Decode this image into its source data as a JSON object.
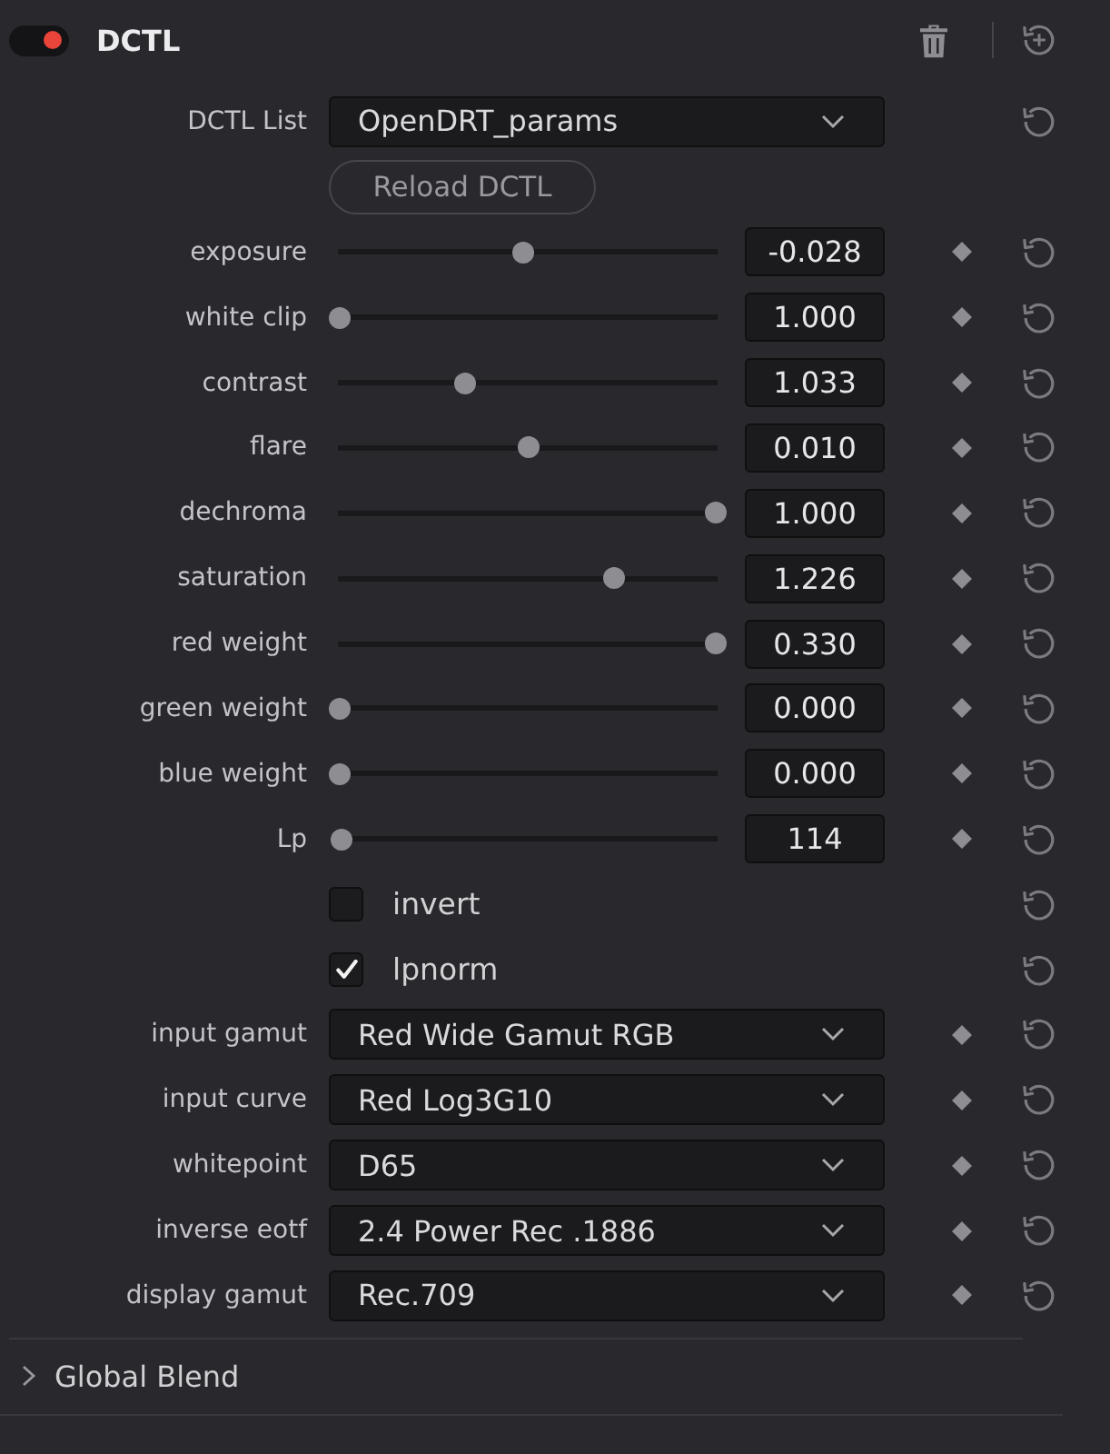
{
  "header": {
    "title": "DCTL",
    "enabled": true
  },
  "dctl_list": {
    "label": "DCTL List",
    "value": "OpenDRT_params",
    "button": "Reload DCTL"
  },
  "params": [
    {
      "kind": "slider",
      "label": "exposure",
      "level": 0.49,
      "value": "-0.028"
    },
    {
      "kind": "slider",
      "label": "white clip",
      "level": 0,
      "value": "1.000"
    },
    {
      "kind": "slider",
      "label": "contrast",
      "level": 0.335,
      "value": "1.033"
    },
    {
      "kind": "slider",
      "label": "flare",
      "level": 0.5,
      "value": "0.010"
    },
    {
      "kind": "slider",
      "label": "dechroma",
      "level": 1,
      "value": "1.000"
    },
    {
      "kind": "slider",
      "label": "saturation",
      "level": 0.73,
      "value": "1.226"
    },
    {
      "kind": "slider",
      "label": "red weight",
      "level": 1,
      "value": "0.330"
    },
    {
      "kind": "slider",
      "label": "green weight",
      "level": 0,
      "value": "0.000"
    },
    {
      "kind": "slider",
      "label": "blue weight",
      "level": 0,
      "value": "0.000"
    },
    {
      "kind": "slider",
      "label": "Lp",
      "level": 0.005,
      "value": "114"
    },
    {
      "kind": "checkbox",
      "label": "invert",
      "checked": false
    },
    {
      "kind": "checkbox",
      "label": "lpnorm",
      "checked": true
    },
    {
      "kind": "dropdown",
      "label": "input gamut",
      "value": "Red Wide Gamut RGB"
    },
    {
      "kind": "dropdown",
      "label": "input curve",
      "value": "Red Log3G10"
    },
    {
      "kind": "dropdown",
      "label": "whitepoint",
      "value": "D65"
    },
    {
      "kind": "dropdown",
      "label": "inverse eotf",
      "value": "2.4 Power Rec .1886"
    },
    {
      "kind": "dropdown",
      "label": "display gamut",
      "value": "Rec.709"
    }
  ],
  "sections": [
    {
      "title": "Global Blend",
      "expanded": false
    }
  ]
}
